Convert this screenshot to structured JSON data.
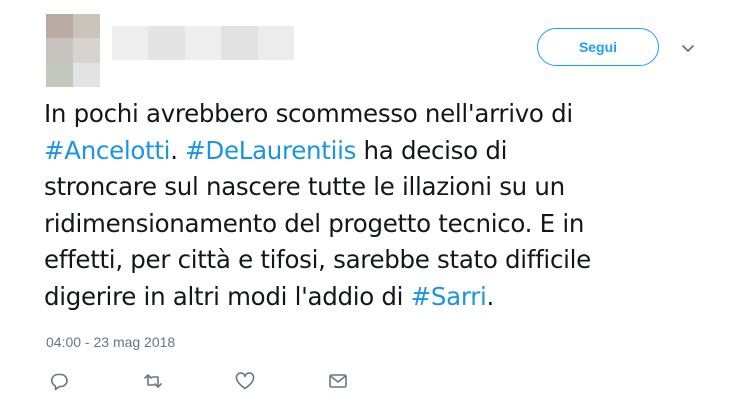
{
  "tweet": {
    "follow_label": "Segui",
    "text": {
      "l1": "In pochi avrebbero scommesso nell'arrivo di",
      "l2_tag1": "#Ancelotti",
      "l2_mid": ". ",
      "l2_tag2": "#DeLaurentiis",
      "l2_end": " ha deciso di",
      "l3": "stroncare sul nascere tutte le illazioni su un",
      "l4": "ridimensionamento del progetto tecnico. E in",
      "l5": "effetti, per città e tifosi, sarebbe stato difficile",
      "l6_start": "digerire in altri modi l'addio di ",
      "l6_tag": "#Sarri",
      "l6_end": "."
    },
    "timestamp": "04:00 - 23 mag 2018"
  },
  "icons": {
    "more": "chevron-down-icon",
    "reply": "reply-icon",
    "retweet": "retweet-icon",
    "like": "heart-icon",
    "dm": "envelope-icon"
  },
  "colors": {
    "accent": "#1da1f2",
    "link": "#1b95e0",
    "text": "#14171a",
    "muted": "#657786"
  }
}
